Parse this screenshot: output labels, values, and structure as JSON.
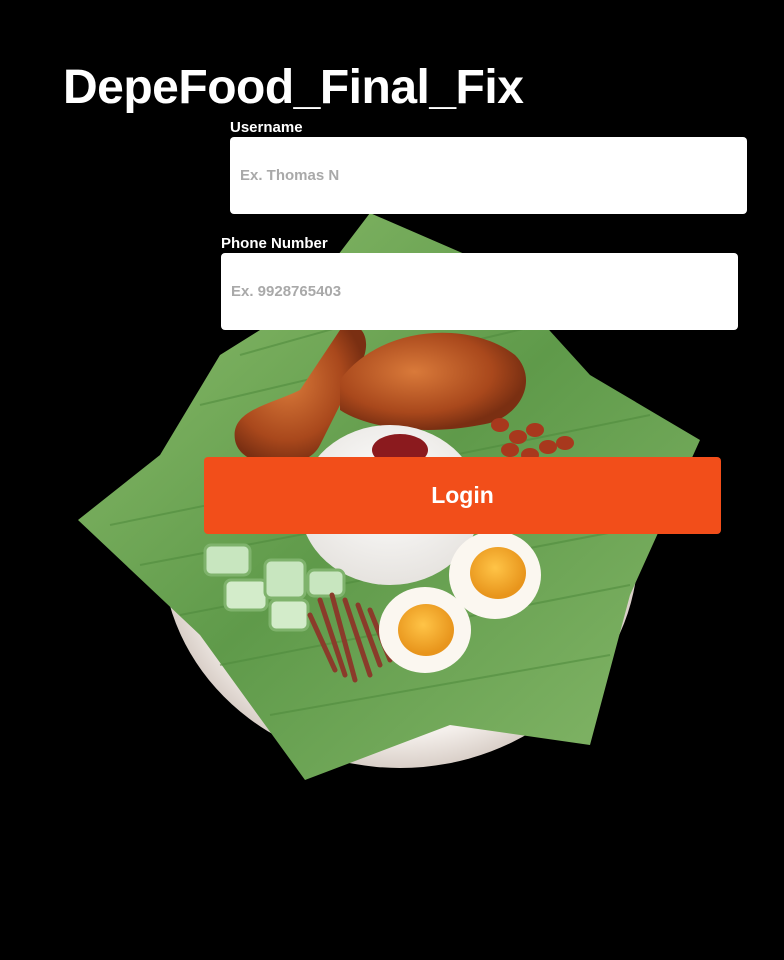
{
  "app": {
    "title": "DepeFood_Final_Fix"
  },
  "form": {
    "username": {
      "label": "Username",
      "placeholder": "Ex. Thomas N",
      "value": ""
    },
    "phone": {
      "label": "Phone Number",
      "placeholder": "Ex. 9928765403",
      "value": ""
    },
    "login_label": "Login"
  },
  "illustration": {
    "icon": "nasi-lemak-plate-illustration"
  },
  "colors": {
    "background": "#000000",
    "accent": "#f24e1a",
    "input_background": "#ffffff",
    "placeholder": "#a9a9a9",
    "text": "#ffffff"
  }
}
